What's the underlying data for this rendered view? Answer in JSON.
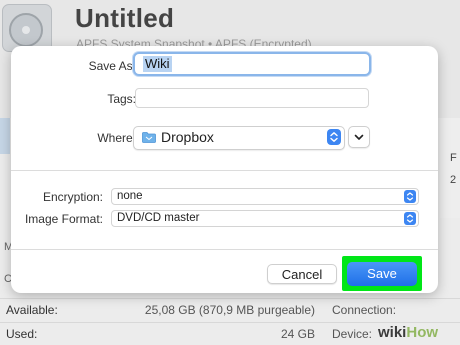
{
  "background": {
    "title": "Untitled",
    "subtitle": "APFS System Snapshot • APFS (Encrypted)",
    "right_panel": {
      "label": "F",
      "value": "2"
    },
    "left_stubs": [
      "M",
      "C"
    ],
    "rows": [
      {
        "label": "Available:",
        "value": "25,08 GB (870,9 MB purgeable)",
        "label2": "Connection:"
      },
      {
        "label": "Used:",
        "value": "24 GB",
        "label2": "Device:"
      }
    ]
  },
  "dialog": {
    "save_as_label": "Save As:",
    "save_as_value": "Wiki",
    "tags_label": "Tags:",
    "tags_value": "",
    "where_label": "Where:",
    "where_value": "Dropbox",
    "encryption_label": "Encryption:",
    "encryption_value": "none",
    "image_format_label": "Image Format:",
    "image_format_value": "DVD/CD master",
    "cancel_label": "Cancel",
    "save_label": "Save",
    "save_highlight_color": "#00e617"
  },
  "icons": {
    "disk": "disk-image-icon",
    "folder": "folder-icon",
    "stepper": "up-down-chevron-icon",
    "expand": "chevron-down-icon"
  },
  "watermark": {
    "wiki": "wiki",
    "how": "How"
  }
}
